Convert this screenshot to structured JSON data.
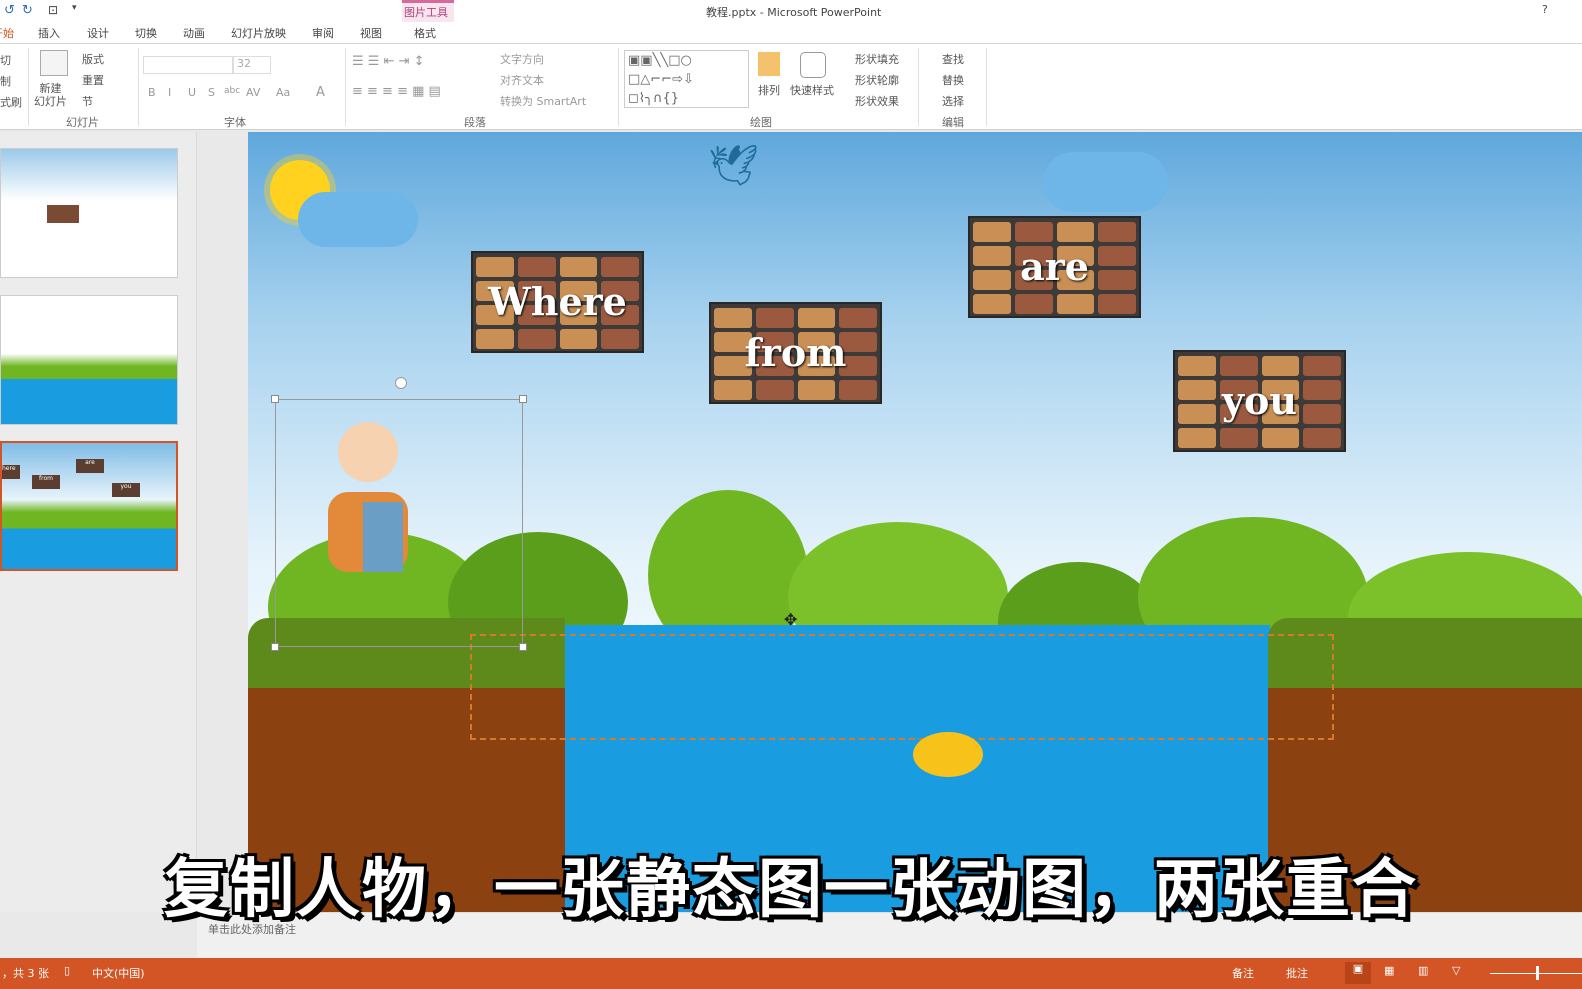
{
  "window": {
    "title": "教程.pptx - Microsoft PowerPoint",
    "help": "?"
  },
  "contextual_tab": {
    "group": "图片工具",
    "tab": "格式",
    "color": "#e8a6c8"
  },
  "tabs": [
    "开始",
    "插入",
    "设计",
    "切换",
    "动画",
    "幻灯片放映",
    "审阅",
    "视图"
  ],
  "ribbon": {
    "clipboard": {
      "items": [
        "切",
        "制",
        "式刷"
      ]
    },
    "slides": {
      "label": "幻灯片",
      "new_slide": "新建\n幻灯片",
      "layout": "版式",
      "reset": "重置",
      "section": "节"
    },
    "font": {
      "label": "字体",
      "size": "32",
      "buttons": [
        "B",
        "I",
        "U",
        "S",
        "abc",
        "AV",
        "Aa",
        "A"
      ]
    },
    "paragraph": {
      "label": "段落",
      "text_direction": "文字方向",
      "align_text": "对齐文本",
      "smartart": "转换为 SmartArt"
    },
    "drawing": {
      "label": "绘图",
      "arrange": "排列",
      "quick_styles": "快速样式",
      "shape_fill": "形状填充",
      "shape_outline": "形状轮廓",
      "shape_effects": "形状效果"
    },
    "editing": {
      "label": "编辑",
      "find": "查找",
      "replace": "替换",
      "select": "选择"
    }
  },
  "slide": {
    "words": [
      "Where",
      "from",
      "are",
      "you"
    ],
    "colors": {
      "water": "#1a9de0",
      "grass": "#5e8a1c",
      "dirt": "#8b4210",
      "bush": "#6fb622"
    }
  },
  "thumbnails": [
    {
      "selected": false
    },
    {
      "selected": false
    },
    {
      "selected": true,
      "words": [
        "here",
        "from",
        "are",
        "you"
      ]
    }
  ],
  "notes_placeholder": "单击此处添加备注",
  "subtitle": "复制人物，一张静态图一张动图，两张重合",
  "status": {
    "slide_count": "，共 3 张",
    "language": "中文(中国)",
    "notes": "备注",
    "comments": "批注",
    "accent": "#d35424"
  }
}
